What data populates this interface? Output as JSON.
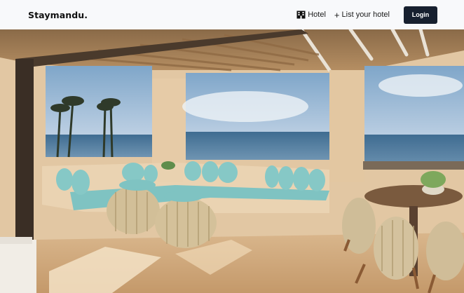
{
  "header": {
    "logo": "Staymandu.",
    "nav": {
      "hotel_label": "Hotel",
      "list_hotel_label": "List your hotel",
      "login_label": "Login"
    }
  },
  "hero": {
    "image_icon": "hero-image"
  },
  "colors": {
    "nav_bg": "#f8f9fb",
    "button_bg": "#17202f",
    "button_text": "#ffffff"
  }
}
